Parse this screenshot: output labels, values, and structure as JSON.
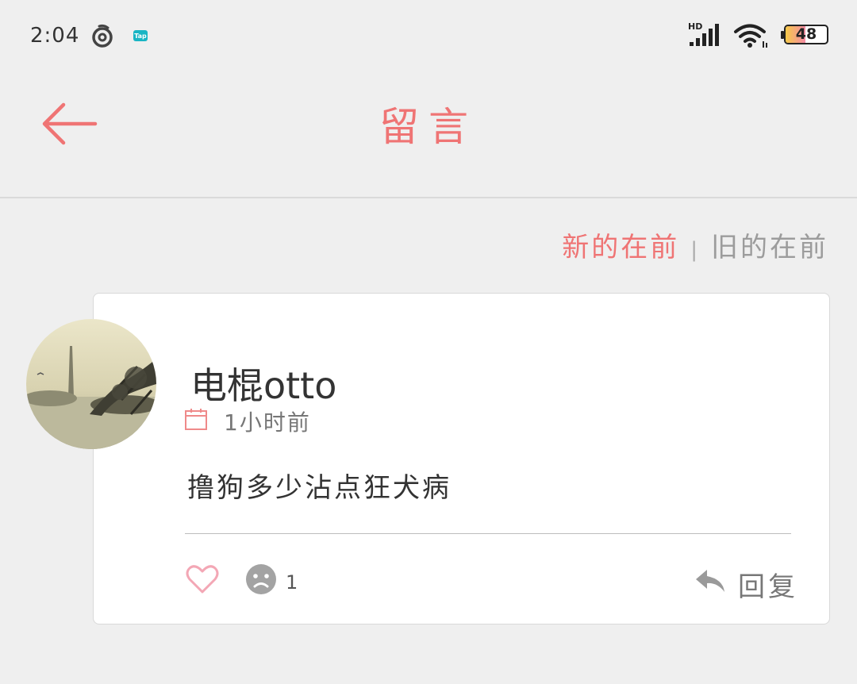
{
  "status_bar": {
    "time": "2:04",
    "battery_level": "48",
    "network_label": "HD",
    "app_icons": [
      "netease-music-icon",
      "taptap-icon"
    ],
    "system_icons": [
      "signal-icon",
      "wifi-icon",
      "battery-icon"
    ]
  },
  "header": {
    "title": "留言",
    "back_icon": "arrow-left-icon",
    "accent_color": "#ef7474"
  },
  "sort": {
    "newest_label": "新的在前",
    "separator": "|",
    "oldest_label": "旧的在前",
    "selected": "newest"
  },
  "comments": [
    {
      "username": "电棍otto",
      "time": "1小时前",
      "text": "撸狗多少沾点狂犬病",
      "dislike_count": "1",
      "reply_label": "回复",
      "icons": [
        "heart-outline-icon",
        "sad-face-icon",
        "reply-arrow-icon",
        "calendar-icon"
      ]
    }
  ]
}
